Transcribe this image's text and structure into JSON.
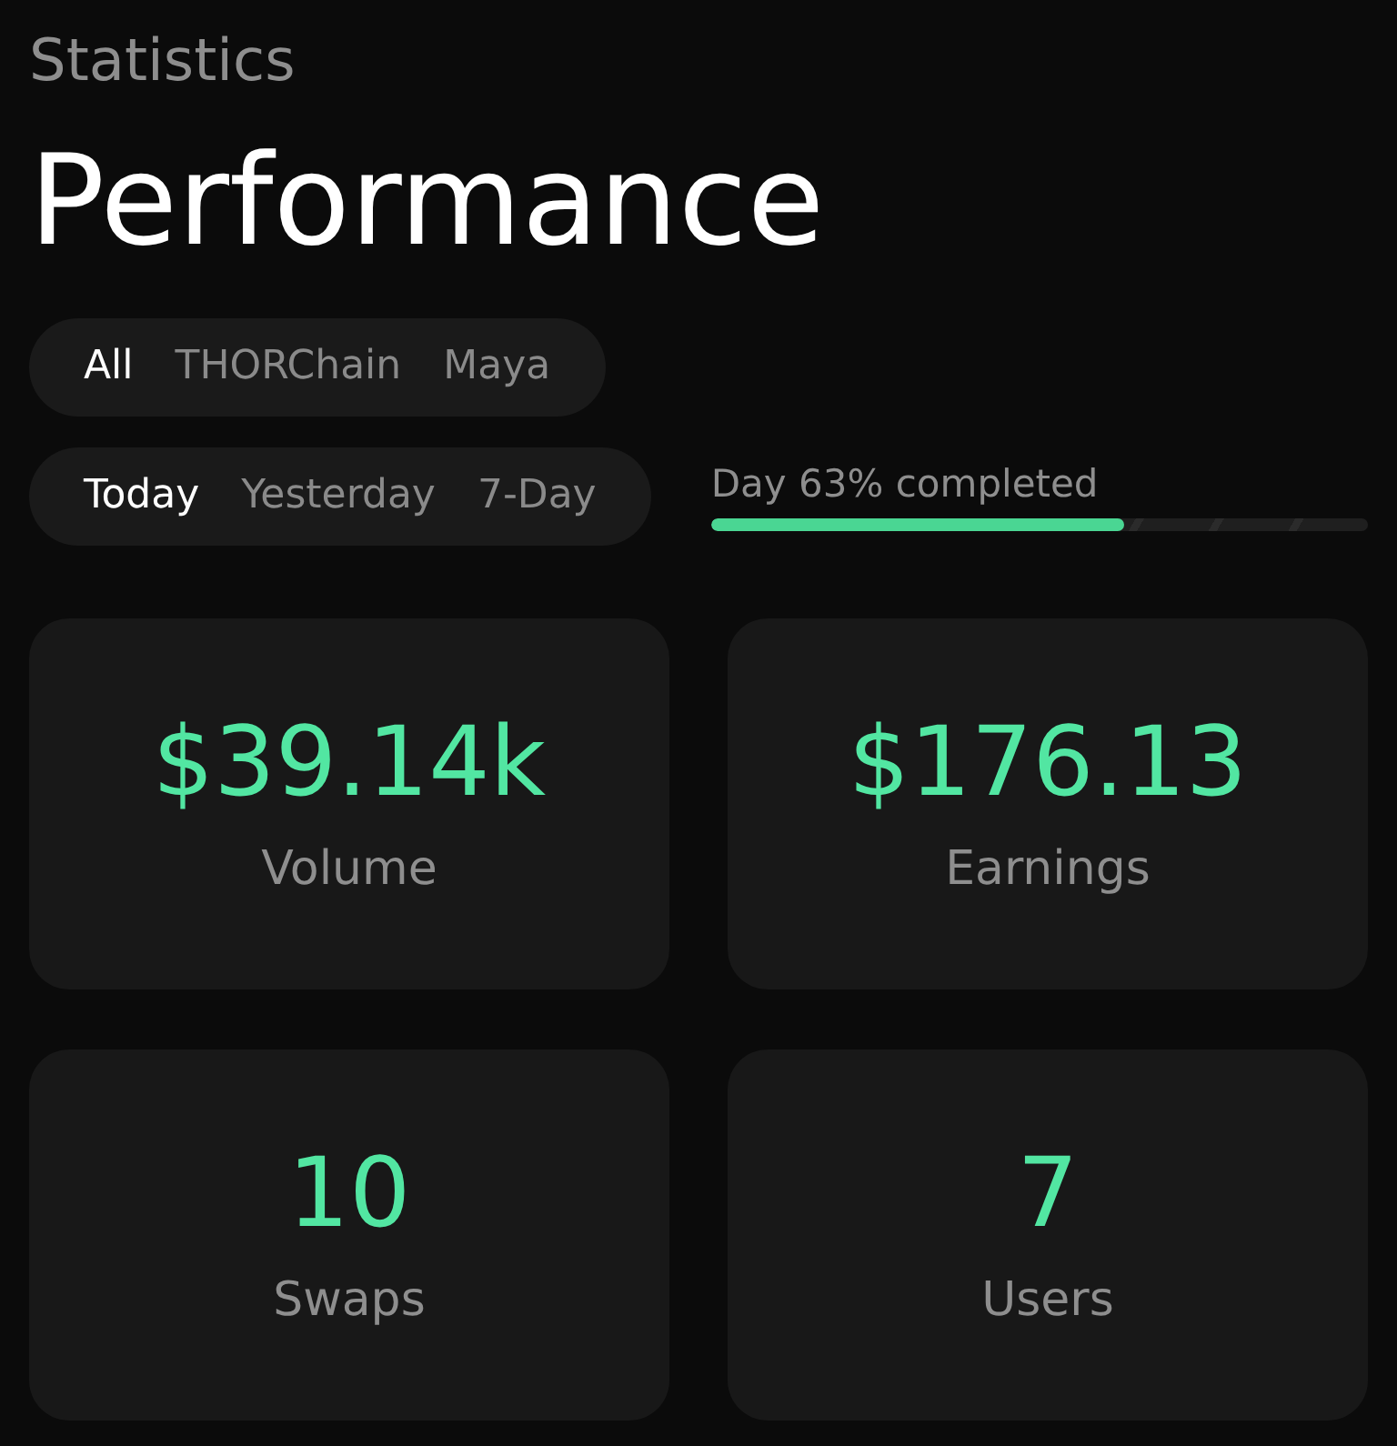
{
  "header": {
    "subtitle": "Statistics",
    "title": "Performance"
  },
  "chain_tabs": [
    {
      "label": "All",
      "selected": true
    },
    {
      "label": "THORChain",
      "selected": false
    },
    {
      "label": "Maya",
      "selected": false
    }
  ],
  "period_tabs": [
    {
      "label": "Today",
      "selected": true
    },
    {
      "label": "Yesterday",
      "selected": false
    },
    {
      "label": "7-Day",
      "selected": false
    }
  ],
  "day_progress": {
    "label": "Day 63% completed",
    "level": 0.63
  },
  "stats": [
    {
      "value": "$39.14k",
      "label": "Volume"
    },
    {
      "value": "$176.13",
      "label": "Earnings"
    },
    {
      "value": "10",
      "label": "Swaps"
    },
    {
      "value": "7",
      "label": "Users"
    }
  ]
}
